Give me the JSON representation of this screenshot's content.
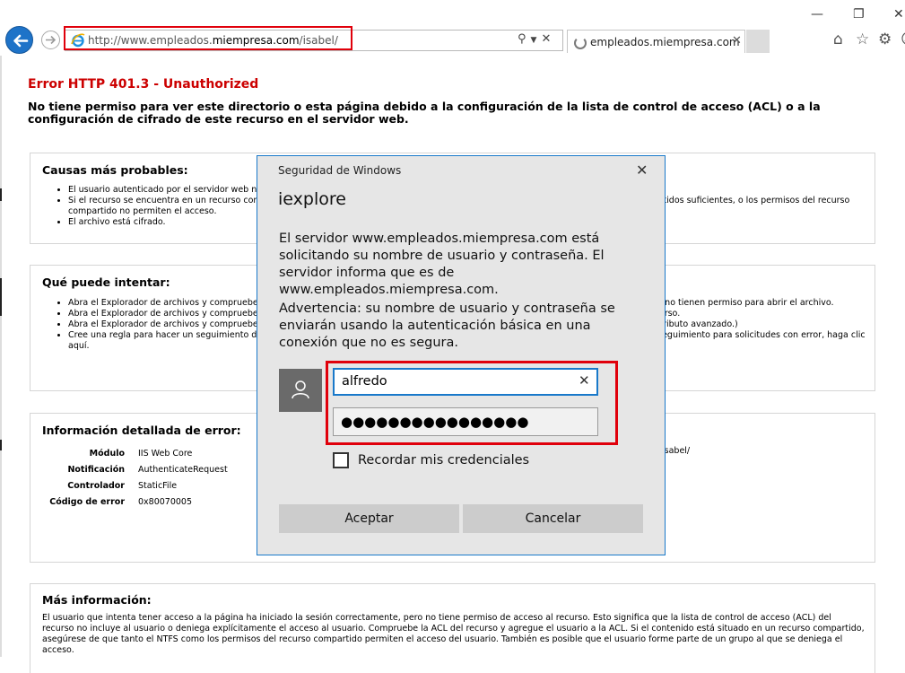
{
  "browser": {
    "url_prefix": "http://www.empleados.",
    "url_domain": "miempresa.com",
    "url_path": "/isabel/",
    "tab_title": "empleados.miempresa.com",
    "window_controls": [
      "—",
      "❐",
      "✕"
    ],
    "icons": [
      "home-icon",
      "star-icon",
      "gear-icon",
      "smiley-icon"
    ]
  },
  "page": {
    "error_title": "Error HTTP 401.3 - Unauthorized",
    "error_description": "No tiene permiso para ver este directorio o esta página debido a la configuración de la lista de control de acceso (ACL) o a la configuración de cifrado de este recurso en el servidor web.",
    "causes": {
      "heading": "Causas más probables:",
      "items": [
        "El usuario autenticado por el servidor web no tiene acceso a un recurso.",
        "Si el recurso se encuentra en un recurso compartido de red, el usuario o el equipo podría no disponer de permisos NTFS y recursos compartidos suficientes, o los permisos del recurso compartido no permiten el acceso.",
        "El archivo está cifrado."
      ]
    },
    "actions": {
      "heading": "Qué puede intentar:",
      "items": [
        "Abra el Explorador de archivos y compruebe los permisos NTFS del recurso. Conceda explícitamente el acceso al sitio web al usuario y que no tienen permiso para abrir el archivo.",
        "Abra el Explorador de archivos y compruebe los permisos del recurso compartido. Permita explícitamente al usuario obtener acceso al recurso.",
        "Abra el Explorador de archivos y compruebe si el archivo está cifrado. Desactive esta opción en el cuadro de diálogo de propiedades del atributo avanzado.)",
        "Cree una regla para hacer un seguimiento de las solicitudes con errores. Para obtener más información sobre la creación de una regla de seguimiento para solicitudes con error, haga clic aquí."
      ]
    },
    "details": {
      "heading": "Información detallada de error:",
      "rows": [
        {
          "key": "Módulo",
          "value": "IIS Web Core"
        },
        {
          "key": "Notificación",
          "value": "AuthenticateRequest"
        },
        {
          "key": "Controlador",
          "value": "StaticFile"
        },
        {
          "key": "Código de error",
          "value": "0x80070005"
        }
      ],
      "extra": "isabel/"
    },
    "more": {
      "heading": "Más información:",
      "text": "El usuario que intenta tener acceso a la página ha iniciado la sesión correctamente, pero no tiene permiso de acceso al recurso. Esto significa que la lista de control de acceso (ACL) del recurso no incluye al usuario o deniega explícitamente el acceso al usuario. Compruebe la ACL del recurso y agregue el usuario a la ACL. Si el contenido está situado en un recurso compartido, asegúrese de que tanto el NTFS como los permisos del recurso compartido permiten el acceso del usuario. También es posible que el usuario forme parte de un grupo al que se deniega el acceso."
    }
  },
  "dialog": {
    "caption": "Seguridad de Windows",
    "app_name": "iexplore",
    "message": "El servidor www.empleados.miempresa.com está solicitando su nombre de usuario y contraseña. El servidor informa que es de www.empleados.miempresa.com.",
    "warning": "Advertencia: su nombre de usuario y contraseña se enviarán usando la autenticación básica en una conexión que no es segura.",
    "username": "alfredo",
    "password_mask": "●●●●●●●●●●●●●●●●",
    "remember_label": "Recordar mis credenciales",
    "ok_label": "Aceptar",
    "cancel_label": "Cancelar",
    "close_glyph": "✕"
  }
}
